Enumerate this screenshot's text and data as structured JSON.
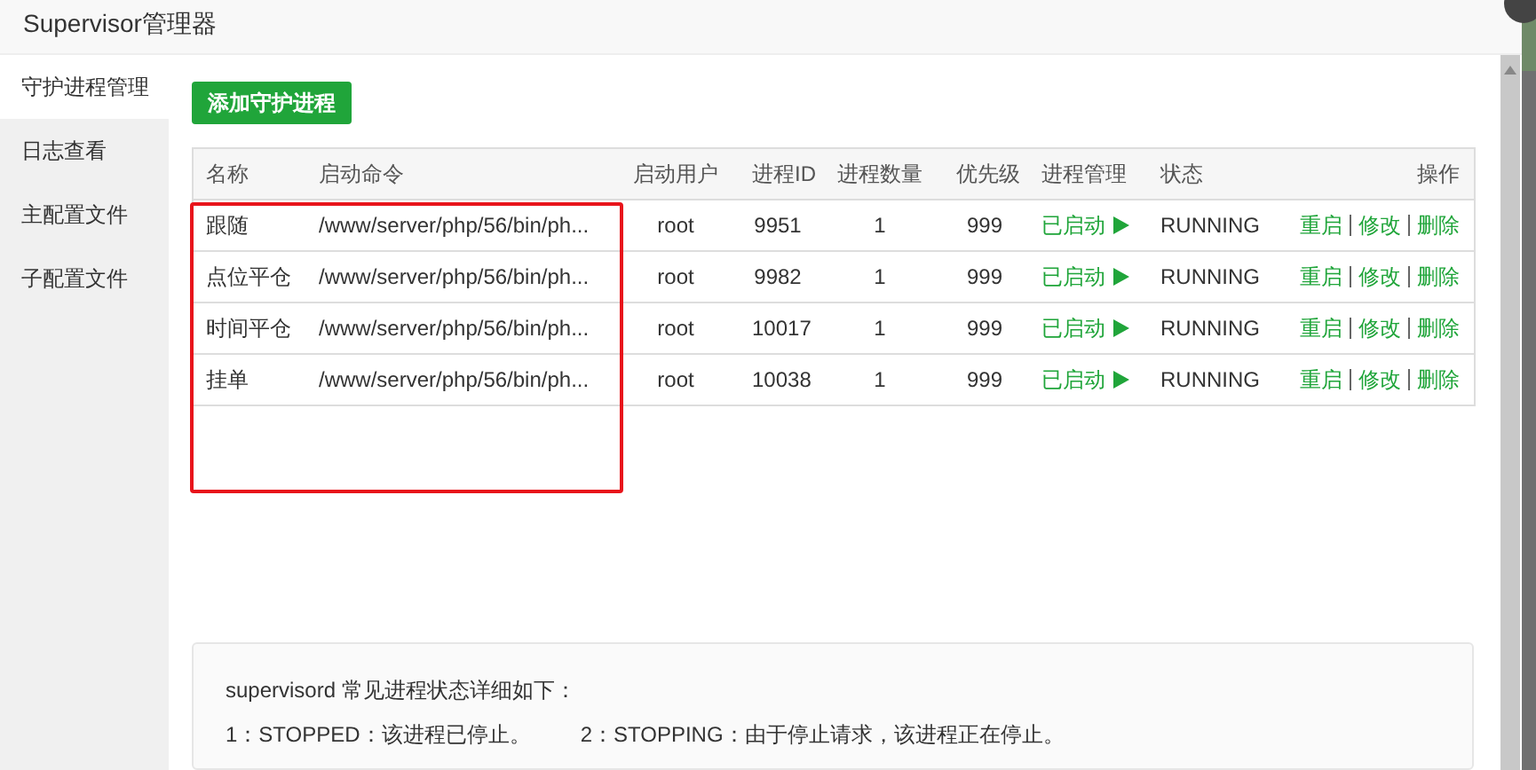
{
  "window": {
    "title": "Supervisor管理器"
  },
  "sidebar": {
    "items": [
      {
        "label": "守护进程管理",
        "selected": true
      },
      {
        "label": "日志查看",
        "selected": false
      },
      {
        "label": "主配置文件",
        "selected": false
      },
      {
        "label": "子配置文件",
        "selected": false
      }
    ]
  },
  "add_button": {
    "label": "添加守护进程"
  },
  "table": {
    "columns": [
      "名称",
      "启动命令",
      "启动用户",
      "进程ID",
      "进程数量",
      "优先级",
      "进程管理",
      "状态",
      "操作"
    ],
    "rows": [
      {
        "name": "跟随",
        "command": "/www/server/php/56/bin/ph...",
        "user": "root",
        "pid": "9951",
        "count": "1",
        "priority": "999",
        "manage": "已启动",
        "running": true,
        "status": "RUNNING",
        "actions": [
          "重启",
          "修改",
          "删除"
        ]
      },
      {
        "name": "点位平仓",
        "command": "/www/server/php/56/bin/ph...",
        "user": "root",
        "pid": "9982",
        "count": "1",
        "priority": "999",
        "manage": "已启动",
        "running": true,
        "status": "RUNNING",
        "actions": [
          "重启",
          "修改",
          "删除"
        ]
      },
      {
        "name": "时间平仓",
        "command": "/www/server/php/56/bin/ph...",
        "user": "root",
        "pid": "10017",
        "count": "1",
        "priority": "999",
        "manage": "已启动",
        "running": true,
        "status": "RUNNING",
        "actions": [
          "重启",
          "修改",
          "删除"
        ]
      },
      {
        "name": "挂单",
        "command": "/www/server/php/56/bin/ph...",
        "user": "root",
        "pid": "10038",
        "count": "1",
        "priority": "999",
        "manage": "已启动",
        "running": true,
        "status": "RUNNING",
        "actions": [
          "重启",
          "修改",
          "删除"
        ]
      }
    ]
  },
  "info": {
    "heading": "supervisord 常见进程状态详细如下：",
    "items": [
      "1：STOPPED：该进程已停止。",
      "2：STOPPING：由于停止请求，该进程正在停止。"
    ]
  }
}
